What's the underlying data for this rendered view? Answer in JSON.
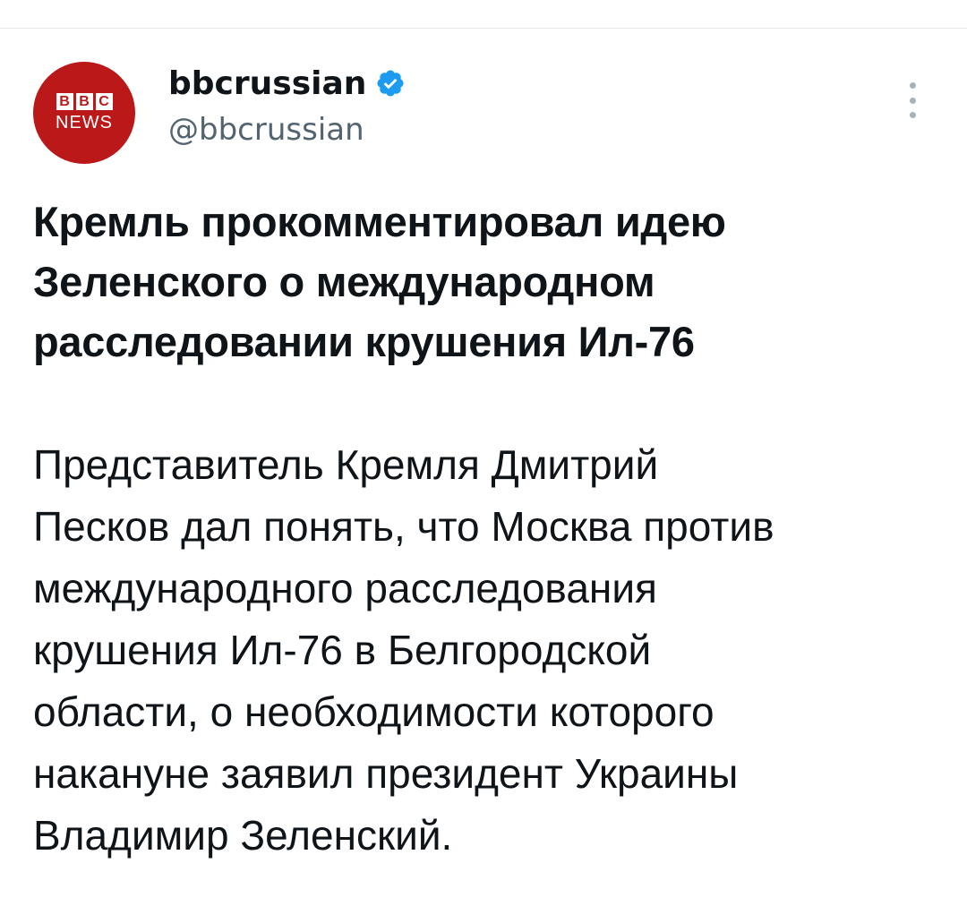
{
  "tweet": {
    "avatar": {
      "brand_letters": [
        "B",
        "B",
        "C"
      ],
      "brand_sub": "NEWS",
      "bg_color": "#bb1919"
    },
    "author": {
      "display_name": "bbcrussian",
      "handle": "@bbcrussian",
      "verified": true,
      "verified_icon": "verified-badge-icon",
      "verified_color": "#1d9bf0"
    },
    "more_icon": "more-vertical-icon",
    "headline": "Кремль прокомментировал идею\nЗеленского о международном\nрасследовании крушения Ил-76",
    "body": "Представитель Кремля Дмитрий\nПесков дал понять, что Москва против\nмеждународного расследования\nкрушения Ил-76 в Белгородской\nобласти, о необходимости которого\nнакануне заявил президент Украины\nВладимир Зеленский."
  }
}
